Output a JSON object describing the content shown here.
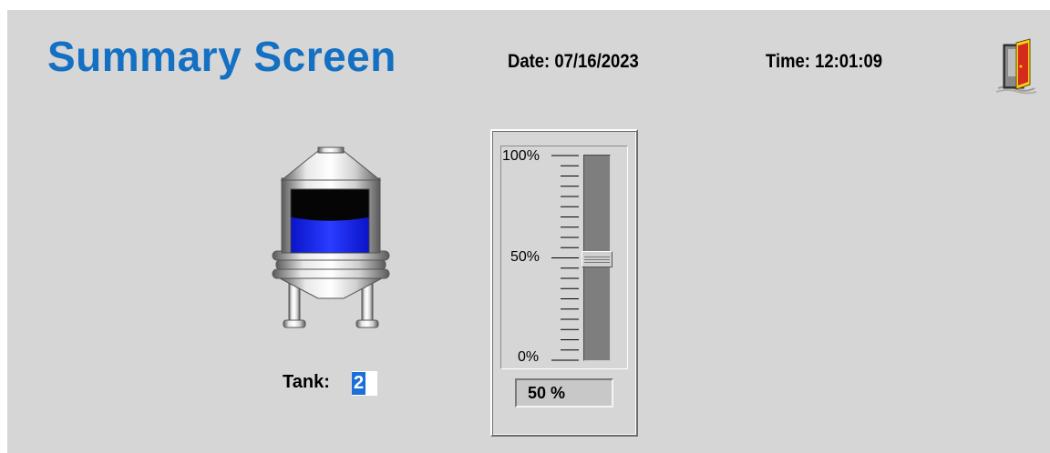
{
  "header": {
    "title": "Summary Screen",
    "date": "Date: 07/16/2023",
    "time": "Time: 12:01:09",
    "exit_icon": "exit-door-icon"
  },
  "tank": {
    "icon": "storage-tank-icon",
    "level_fraction": 0.56,
    "label": "Tank:",
    "number": "2"
  },
  "slider": {
    "label_top": "100%",
    "label_mid": "50%",
    "label_bottom": "0%",
    "value_percent": 50,
    "readout": "50 %"
  },
  "colors": {
    "background": "#d6d6d6",
    "title": "#1470c3",
    "liquid": "#0a1eea",
    "selection": "#1c6fd6"
  }
}
